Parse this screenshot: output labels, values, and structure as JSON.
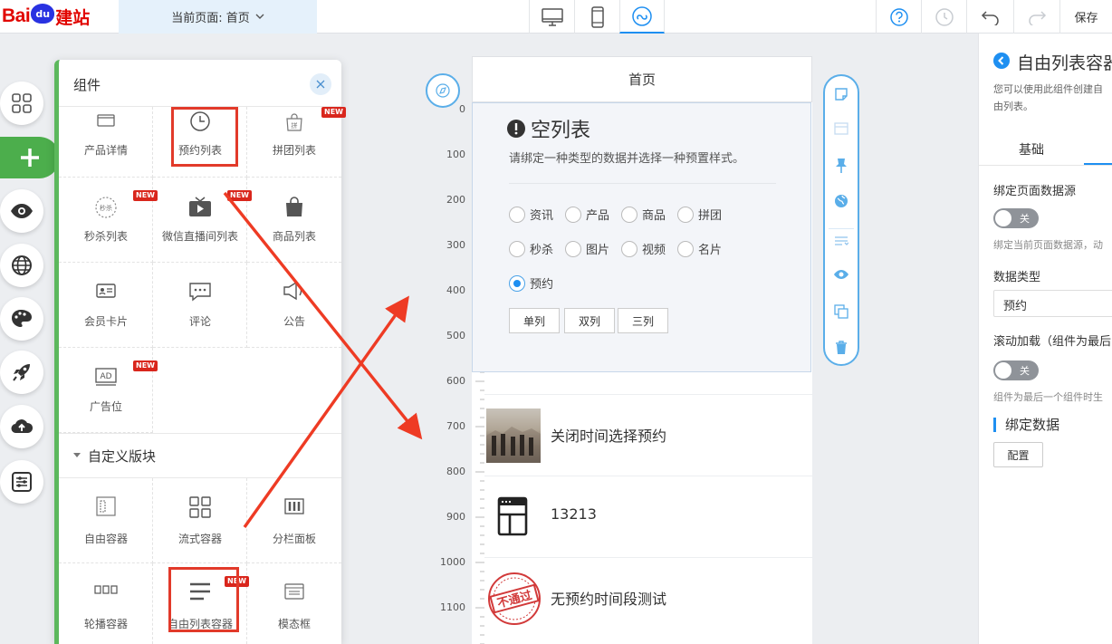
{
  "topbar": {
    "logo_text_bai": "Bai",
    "logo_text_du": "du",
    "logo_text_site": "建站",
    "current_page_label": "当前页面: 首页",
    "save_label": "保存"
  },
  "component_panel": {
    "title": "组件",
    "components": [
      {
        "label": "产品详情",
        "icon": "product-detail-icon",
        "new": false
      },
      {
        "label": "预约列表",
        "icon": "clock-icon",
        "new": false
      },
      {
        "label": "拼团列表",
        "icon": "group-buy-icon",
        "new": true
      },
      {
        "label": "秒杀列表",
        "icon": "flash-sale-icon",
        "new": true
      },
      {
        "label": "微信直播间列表",
        "icon": "tv-icon",
        "new": true
      },
      {
        "label": "商品列表",
        "icon": "shopping-bag-icon",
        "new": false
      },
      {
        "label": "会员卡片",
        "icon": "member-card-icon",
        "new": false
      },
      {
        "label": "评论",
        "icon": "comment-icon",
        "new": false
      },
      {
        "label": "公告",
        "icon": "announcement-icon",
        "new": false
      },
      {
        "label": "广告位",
        "icon": "ad-icon",
        "new": true
      }
    ],
    "custom_section_title": "自定义版块",
    "custom_blocks": [
      {
        "label": "自由容器",
        "icon": "free-container-icon",
        "new": false
      },
      {
        "label": "流式容器",
        "icon": "flow-container-icon",
        "new": false
      },
      {
        "label": "分栏面板",
        "icon": "column-panel-icon",
        "new": false
      },
      {
        "label": "轮播容器",
        "icon": "carousel-icon",
        "new": false
      },
      {
        "label": "自由列表容器",
        "icon": "list-icon",
        "new": true
      },
      {
        "label": "模态框",
        "icon": "modal-icon",
        "new": false
      }
    ],
    "new_badge": "NEW"
  },
  "canvas": {
    "page_title": "首页",
    "ruler_labels": [
      "0",
      "100",
      "200",
      "300",
      "400",
      "500",
      "600",
      "700",
      "800",
      "900",
      "1000",
      "1100"
    ],
    "empty_list": {
      "title": "空列表",
      "description": "请绑定一种类型的数据并选择一种预置样式。",
      "data_types": [
        "资讯",
        "产品",
        "商品",
        "拼团",
        "秒杀",
        "图片",
        "视频",
        "名片",
        "预约"
      ],
      "selected_type": "预约",
      "column_options": [
        "单列",
        "双列",
        "三列"
      ]
    },
    "items": [
      {
        "title": "关闭时间选择预约",
        "thumb": "photo-thumbnail"
      },
      {
        "title": "13213",
        "thumb": "browser-window-icon"
      },
      {
        "title": "无预约时间段测试",
        "thumb": "rejected-stamp",
        "stamp_text": "不通过"
      }
    ]
  },
  "right_panel": {
    "title": "自由列表容器",
    "description": "您可以使用此组件创建自由列表。",
    "tab_basic": "基础",
    "bind_page_datasource_label": "绑定页面数据源",
    "toggle_off_label": "关",
    "bind_page_datasource_hint": "绑定当前页面数据源，动",
    "data_type_label": "数据类型",
    "data_type_value": "预约",
    "scroll_load_label": "滚动加载（组件为最后",
    "scroll_load_hint": "组件为最后一个组件时生",
    "bind_data_title": "绑定数据",
    "configure_button": "配置"
  },
  "colors": {
    "accent_blue": "#1e8ff1",
    "rail_green": "#4cae4c",
    "highlight_red": "#e23a2a",
    "new_badge_red": "#d9261c"
  }
}
